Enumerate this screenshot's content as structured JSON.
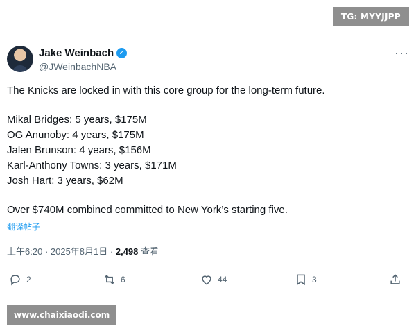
{
  "watermark": {
    "tg": "TG: MYYJJPP",
    "site": "www.chaixiaodi.com"
  },
  "author": {
    "display_name": "Jake Weinbach",
    "handle": "@JWeinbachNBA",
    "verified": true
  },
  "tweet": {
    "intro": "The Knicks are locked in with this core group for the long-term future.",
    "contracts": [
      "Mikal Bridges: 5 years, $175M",
      "OG Anunoby: 4 years, $175M",
      "Jalen Brunson: 4 years, $156M",
      "Karl-Anthony Towns: 3 years, $171M",
      "Josh Hart: 3 years, $62M"
    ],
    "conclusion": "Over $740M combined committed to New York’s starting five.",
    "translate_label": "翻译帖子"
  },
  "meta": {
    "time": "上午6:20",
    "date": "2025年8月1日",
    "views": "2,498",
    "views_label": "查看"
  },
  "actions": {
    "replies": "2",
    "reposts": "6",
    "likes": "44",
    "bookmarks": "3"
  },
  "colors": {
    "accent": "#1d9bf0",
    "text": "#0f1419",
    "muted": "#536471",
    "watermark_bg": "#8f8f8f"
  },
  "icons": [
    "verified-icon",
    "more-icon",
    "reply-icon",
    "repost-icon",
    "like-icon",
    "bookmark-icon",
    "share-icon"
  ]
}
